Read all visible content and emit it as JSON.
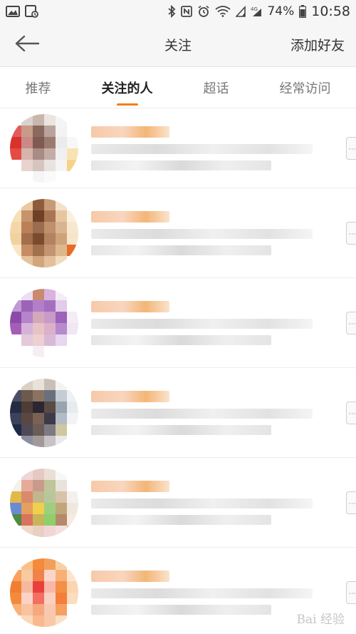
{
  "status_bar": {
    "battery_percent": "74%",
    "time": "10:58",
    "left_icons": [
      "image-icon",
      "gallery-lock-icon"
    ],
    "right_icons": [
      "bluetooth-icon",
      "nfc-icon",
      "alarm-icon",
      "wifi-icon",
      "signal-icon",
      "lte-signal-icon",
      "battery-icon"
    ]
  },
  "header": {
    "title": "关注",
    "back_icon": "back-arrow-icon",
    "right_action": "添加好友"
  },
  "tabs": [
    {
      "label": "推荐",
      "active": false
    },
    {
      "label": "关注的人",
      "active": true
    },
    {
      "label": "超话",
      "active": false
    },
    {
      "label": "经常访问",
      "active": false
    }
  ],
  "accent_color": "#f07f1b",
  "follow_rows": [
    {
      "avatar": [
        "#f7f7f7",
        "#dcd2cd",
        "#c9b7ad",
        "#ece4e0",
        "#f4f4f4",
        "#ffffff",
        "#e35b5b",
        "#c79a8a",
        "#8a6a5e",
        "#b9a39a",
        "#f3f3f3",
        "#ffffff",
        "#d9312e",
        "#c98a85",
        "#7f5a52",
        "#9b7b70",
        "#ecebeb",
        "#f7f7f7",
        "#e44b42",
        "#d6b3ab",
        "#a88c83",
        "#c2aea6",
        "#f0f0f0",
        "#f8e3b3",
        "#ffffff",
        "#e9d3ce",
        "#d6c5bf",
        "#e8e3e1",
        "#f5f5f5",
        "#f6d28a",
        "#ffffff",
        "#ffffff",
        "#f5f5f5",
        "#fafafa",
        "#ffffff",
        "#ffffff"
      ]
    },
    {
      "avatar": [
        "#fbefd9",
        "#e9c9a1",
        "#8d5c3d",
        "#c79b77",
        "#f3e2c8",
        "#ffffff",
        "#f7dfb8",
        "#c7936a",
        "#6e4127",
        "#a87554",
        "#e5c6a1",
        "#fbf0dc",
        "#f4d7a9",
        "#b98059",
        "#9c6c4e",
        "#c18f6c",
        "#d8b592",
        "#f7e7cf",
        "#f1d1a0",
        "#a36e4b",
        "#7b4b2e",
        "#b3825f",
        "#cfa37a",
        "#f5e5c9",
        "#fae6c6",
        "#c68d64",
        "#a0704f",
        "#c49471",
        "#ddb88f",
        "#e86b2a",
        "#ffffff",
        "#e6c29a",
        "#d2a57d",
        "#e3c09b",
        "#f2dcbd",
        "#ffffff"
      ]
    },
    {
      "avatar": [
        "#ffffff",
        "#e9dff0",
        "#c98b6d",
        "#d8b3e0",
        "#f3eef6",
        "#ffffff",
        "#c09ad4",
        "#9c63b8",
        "#b27fcb",
        "#a56ec1",
        "#e1cce9",
        "#ffffff",
        "#8b4aa8",
        "#b683cc",
        "#d4a7b9",
        "#c89ac8",
        "#9b63ba",
        "#f4ecf7",
        "#a55db8",
        "#d5b3d9",
        "#e8c3c5",
        "#dcb0c9",
        "#b68acc",
        "#f0e6f4",
        "#ffffff",
        "#e3c9d9",
        "#ecd0d2",
        "#d9b9d8",
        "#e6d6ee",
        "#ffffff",
        "#ffffff",
        "#ffffff",
        "#f6eef4",
        "#ffffff",
        "#ffffff",
        "#ffffff"
      ]
    },
    {
      "avatar": [
        "#f4f4f4",
        "#d9d0c6",
        "#e8e2db",
        "#c8c0b6",
        "#f3f3f3",
        "#ffffff",
        "#4a4f64",
        "#6e5a4c",
        "#8a7461",
        "#6a6f7c",
        "#c6ccd3",
        "#eef0f2",
        "#252b40",
        "#4e3c37",
        "#2c2630",
        "#5a4a44",
        "#9aa3b0",
        "#e6ebef",
        "#3b425c",
        "#5a4741",
        "#7a6156",
        "#3d3b49",
        "#b3bcc6",
        "#f1f3f5",
        "#1f2a46",
        "#4f4a55",
        "#6a5c57",
        "#7d7a84",
        "#d0c7a0",
        "#ffffff",
        "#ffffff",
        "#8b8fa0",
        "#a29a9a",
        "#c7c3c5",
        "#e9e9e9",
        "#ffffff"
      ]
    },
    {
      "avatar": [
        "#ffffff",
        "#f0d6d6",
        "#e6c9c3",
        "#eadfd4",
        "#f7f7f7",
        "#ffffff",
        "#f2f2ea",
        "#e7a99a",
        "#c99a8c",
        "#c0c49b",
        "#e8e3da",
        "#ffffff",
        "#e2b84a",
        "#d98a6d",
        "#c2b68a",
        "#b8c79a",
        "#d8c3a8",
        "#f4f0ec",
        "#6a8bd2",
        "#e5a05d",
        "#f0cf4d",
        "#9fcf7e",
        "#c2a67a",
        "#f0e8df",
        "#4e8a3f",
        "#d9735e",
        "#c8b55a",
        "#8fcf6a",
        "#b38a6a",
        "#f7eadf",
        "#ffffff",
        "#f0d9c8",
        "#e8cfc2",
        "#f2d6d6",
        "#f4e0e0",
        "#f5c8a8"
      ]
    },
    {
      "avatar": [
        "#ffffff",
        "#f9c18a",
        "#f58b3a",
        "#f39f5c",
        "#f8d0a8",
        "#ffffff",
        "#f7a15d",
        "#f9c9a0",
        "#f0824a",
        "#fad6c8",
        "#f6b078",
        "#fde5cc",
        "#f17e32",
        "#f7b8a0",
        "#e8413c",
        "#f9b7a7",
        "#f58f45",
        "#fbd5b0",
        "#f48a3a",
        "#fbd3c6",
        "#f46e62",
        "#fad0c2",
        "#f47e3a",
        "#fcdcbf",
        "#f9b07a",
        "#f8c4a0",
        "#f6a87e",
        "#f8c9b0",
        "#f5a060",
        "#ffffff",
        "#ffffff",
        "#fbd8b8",
        "#f9b98e",
        "#f9c8a6",
        "#fcdfc6",
        "#ffffff"
      ]
    }
  ],
  "follow_button_glyph": "⋮",
  "watermark": "Bai  经验"
}
